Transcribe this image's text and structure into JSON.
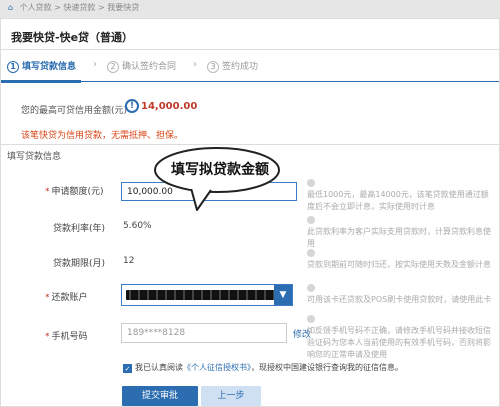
{
  "breadcrumb": {
    "home": "⌂",
    "path": "个人贷款 > 快速贷款 > 我要快贷"
  },
  "page": {
    "title": "我要快贷-快e贷（普通）"
  },
  "steps": [
    {
      "num": "1",
      "label": "填写贷款信息",
      "active": true
    },
    {
      "num": "2",
      "label": "确认签约合同",
      "active": false
    },
    {
      "num": "3",
      "label": "签约成功",
      "active": false
    }
  ],
  "quota": {
    "label": "您的最高可贷信用金额(元)",
    "icon": "info-icon",
    "icon_glyph": "!",
    "value": "14,000.00"
  },
  "notice": "该笔快贷为信用贷款，无需抵押、担保。",
  "section_title": "填写贷款信息",
  "form": {
    "amount": {
      "label": "申请额度(元)",
      "value": "10,000.00"
    },
    "rate": {
      "label": "贷款利率(年)",
      "value": "5.60%"
    },
    "term": {
      "label": "贷款期限(月)",
      "value": "12"
    },
    "account": {
      "label": "还款账户",
      "value": "[masked]"
    },
    "phone": {
      "label": "手机号码",
      "value": "189****8128",
      "modify": "修改"
    }
  },
  "hints": [
    "最低1000元，最高14000元，该笔贷款使用通过额度后不会立即计息，实际使用时计息",
    "此贷款利率为客户实际支用贷款时，计算贷款利息使用",
    "贷款到期前可随时归还，按实际使用天数及金额计息",
    "可用该卡还贷款及POS刷卡使用贷款时，请使用此卡",
    "如反馈手机号码不正确，请修改手机号码并接收短信验证码为您本人当前使用的有效手机号码，否则将影响您的正常申请及使用"
  ],
  "agreement": {
    "prefix": "我已认真阅读",
    "link": "《个人征信授权书》",
    "suffix": "，现授权中国建设银行查询我的征信信息。"
  },
  "buttons": {
    "submit": "提交审批",
    "prev": "上一步"
  },
  "annotation": "填写拟贷款金额",
  "colors": {
    "brand": "#2b6db0",
    "accent_red": "#c0392b",
    "notice": "#d84315"
  }
}
